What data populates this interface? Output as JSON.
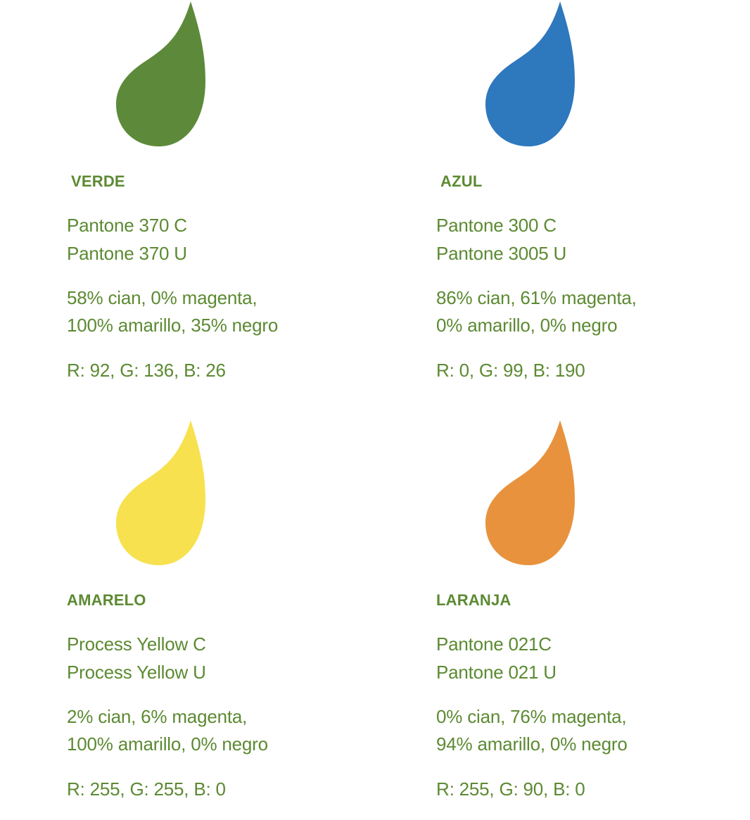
{
  "text_color": "#5c8a32",
  "swatches": [
    {
      "name": "VERDE",
      "color": "#5c8a3a",
      "pantone_c": "Pantone 370 C",
      "pantone_u": "Pantone 370 U",
      "cmyk_line1": "58% cian, 0% magenta,",
      "cmyk_line2": "100% amarillo, 35% negro",
      "rgb": "R: 92, G: 136, B: 26"
    },
    {
      "name": "AZUL",
      "color": "#2e78bd",
      "pantone_c": "Pantone 300 C",
      "pantone_u": "Pantone 3005 U",
      "cmyk_line1": "86% cian, 61% magenta,",
      "cmyk_line2": "0% amarillo, 0% negro",
      "rgb": "R: 0, G: 99, B: 190"
    },
    {
      "name": "AMARELO",
      "color": "#f7e14f",
      "pantone_c": "Process Yellow C",
      "pantone_u": "Process Yellow U",
      "cmyk_line1": "2% cian, 6% magenta,",
      "cmyk_line2": "100% amarillo, 0% negro",
      "rgb": "R: 255, G: 255, B: 0"
    },
    {
      "name": "LARANJA",
      "color": "#e8923e",
      "pantone_c": "Pantone 021C",
      "pantone_u": "Pantone 021 U",
      "cmyk_line1": "0% cian, 76% magenta,",
      "cmyk_line2": "94% amarillo, 0% negro",
      "rgb": "R: 255, G: 90, B: 0"
    }
  ]
}
